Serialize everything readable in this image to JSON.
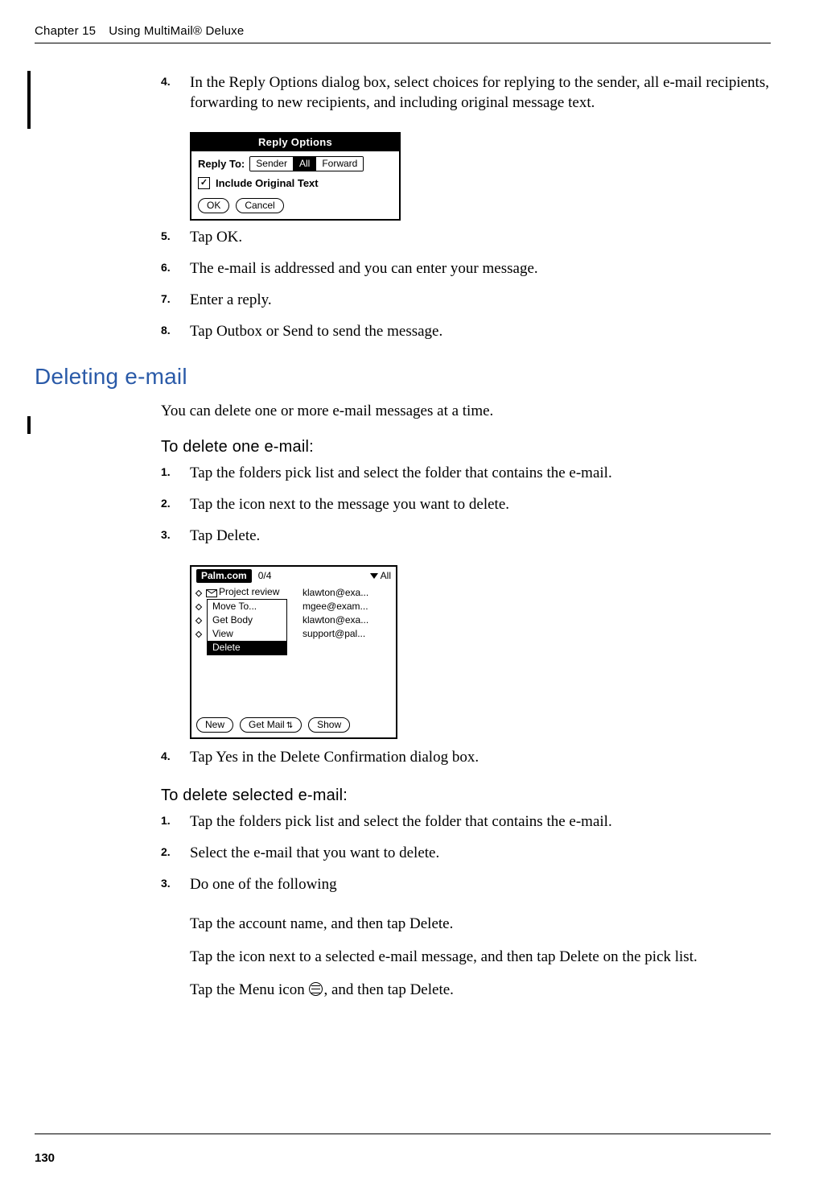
{
  "header": {
    "chapter": "Chapter 15",
    "title": "Using MultiMail® Deluxe"
  },
  "page_number": "130",
  "steps_a": [
    {
      "n": "4",
      "t": "In the Reply Options dialog box, select choices for replying to the sender, all e-mail recipients, forwarding to new recipients, and including original message text."
    },
    {
      "n": "5",
      "t": "Tap OK."
    },
    {
      "n": "6",
      "t": "The e-mail is addressed and you can enter your message."
    },
    {
      "n": "7",
      "t": "Enter a reply."
    },
    {
      "n": "8",
      "t": "Tap Outbox or Send to send the message."
    }
  ],
  "reply_dialog": {
    "title": "Reply Options",
    "label": "Reply To:",
    "opts": [
      "Sender",
      "All",
      "Forward"
    ],
    "selected": "All",
    "checkbox": "Include Original Text",
    "ok": "OK",
    "cancel": "Cancel"
  },
  "section_heading": "Deleting e-mail",
  "section_intro": "You can delete one or more e-mail messages at a time.",
  "proc1_heading": "To delete one e-mail:",
  "proc1_steps": [
    {
      "n": "1",
      "t": "Tap the folders pick list and select the folder that contains the e-mail."
    },
    {
      "n": "2",
      "t": "Tap the icon next to the message you want to delete."
    },
    {
      "n": "3",
      "t": "Tap Delete."
    },
    {
      "n": "4",
      "t": "Tap Yes in the Delete Confirmation dialog box."
    }
  ],
  "mail_dialog": {
    "account": "Palm.com",
    "count": "0/4",
    "pick": "All",
    "first_subject": "Project review",
    "menu": [
      "Move To...",
      "Get Body",
      "View",
      "Delete"
    ],
    "menu_selected": "Delete",
    "addrs": [
      "klawton@exa...",
      "mgee@exam...",
      "klawton@exa...",
      "support@pal..."
    ],
    "btn_new": "New",
    "btn_get": "Get Mail",
    "btn_show": "Show"
  },
  "proc2_heading": "To delete selected e-mail:",
  "proc2_steps": [
    {
      "n": "1",
      "t": "Tap the folders pick list and select the folder that contains the e-mail."
    },
    {
      "n": "2",
      "t": "Select the e-mail that you want to delete."
    },
    {
      "n": "3",
      "t": "Do one of the following"
    }
  ],
  "proc2_sub": [
    "Tap the account name, and then tap Delete.",
    "Tap the icon next to a selected e-mail message, and then tap Delete on the pick list.",
    "Tap the Menu icon , and then tap Delete."
  ],
  "proc2_sub_icon_prefix": "Tap the Menu icon ",
  "proc2_sub_icon_suffix": ", and then tap Delete."
}
